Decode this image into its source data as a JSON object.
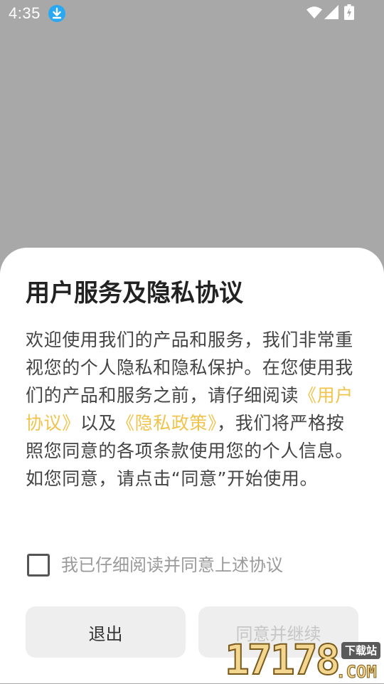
{
  "status_bar": {
    "time": "4:35",
    "icons": [
      "download-icon",
      "wifi-icon",
      "signal-icon",
      "battery-charging-icon"
    ]
  },
  "dialog": {
    "title": "用户服务及隐私协议",
    "body_intro": "欢迎使用我们的产品和服务，我们非常重视您的个人隐私和隐私保护。在您使用我们的产品和服务之前，请仔细阅读",
    "user_agreement_link": "《用户协议》",
    "body_and": "以及",
    "privacy_policy_link": "《隐私政策》",
    "body_outro": "，我们将严格按照您同意的各项条款使用您的个人信息。如您同意，请点击“同意”开始使用。",
    "consent_label": "我已仔细阅读并同意上述协议",
    "exit_label": "退出",
    "agree_label": "同意并继续"
  },
  "colors": {
    "backdrop": "#a8a8a8",
    "link": "#f0c44c",
    "button_bg": "#eeeeee",
    "disabled_text": "#c6c6c6"
  },
  "watermark": {
    "main": "17178",
    "suffix": ".COM",
    "tag": "下载站"
  }
}
